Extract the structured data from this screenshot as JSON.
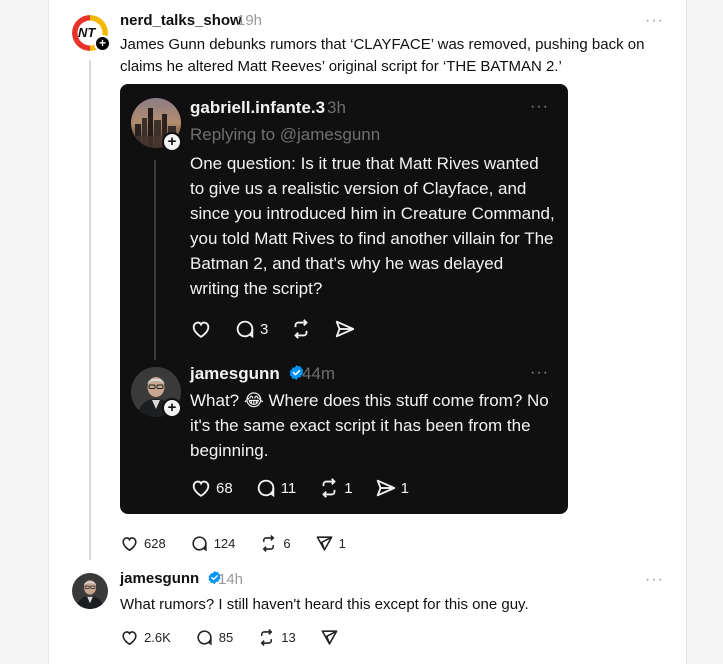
{
  "post": {
    "username": "nerd_talks_show",
    "time": "19h",
    "avatar_text": "NT",
    "text": "James Gunn debunks rumors that ‘CLAYFACE’ was removed, pushing back on claims he altered Matt Reeves’ original script for ‘THE BATMAN 2.’",
    "more_label": "···",
    "likes": "628",
    "replies": "124",
    "reposts": "6",
    "shares": "1"
  },
  "embedded": {
    "first": {
      "username": "gabriell.infante.3",
      "time": "3h",
      "replying_to": "Replying to @jamesgunn",
      "text": "One question: Is it true that Matt Rives wanted to give us a realistic version of Clayface, and since you introduced him in Creature Command, you told Matt Rives to find another villain for The Batman 2, and that's why he was delayed writing the script?",
      "replies": "3"
    },
    "second": {
      "username": "jamesgunn",
      "time": "44m",
      "text": "What? 😂 Where does this stuff come from? No it's the same exact script it has been from the beginning.",
      "likes": "68",
      "replies": "11",
      "reposts": "1",
      "shares": "1"
    }
  },
  "reply": {
    "username": "jamesgunn",
    "time": "14h",
    "text": "What rumors? I still haven't heard this except for this one guy.",
    "likes": "2.6K",
    "replies": "85",
    "reposts": "13"
  },
  "icons": {
    "heart": "heart-icon",
    "comment": "comment-icon",
    "repost": "repost-icon",
    "share": "share-icon",
    "verified": "verified-badge-icon",
    "plus": "plus-icon",
    "more": "more-icon"
  },
  "colors": {
    "verified_blue": "#0095f6",
    "dark_bg": "#101010",
    "nt_red": "#e8332c",
    "nt_yellow": "#f5b800"
  }
}
